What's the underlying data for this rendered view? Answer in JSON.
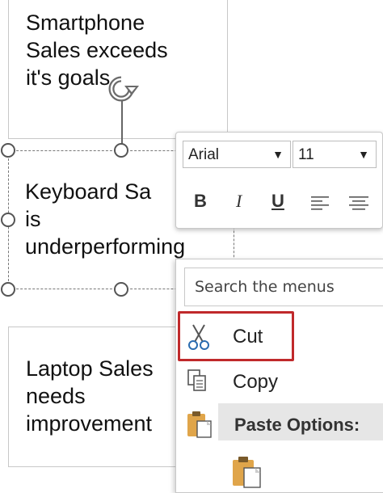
{
  "textboxes": {
    "smartphone": "Smartphone\nSales exceeds\nit's goals",
    "keyboard": "Keyboard Sa\nis\nunderperforming",
    "laptop": "Laptop Sales\nneeds\nimprovement"
  },
  "mini_toolbar": {
    "font_name": "Arial",
    "font_size": "11",
    "bold_label": "B",
    "italic_label": "I",
    "underline_label": "U"
  },
  "context_menu": {
    "search_placeholder": "Search the menus",
    "items": [
      {
        "label": "Cut",
        "icon": "scissors-icon"
      },
      {
        "label": "Copy",
        "icon": "copy-icon"
      },
      {
        "label": "Paste Options:",
        "icon": "paste-icon"
      }
    ]
  },
  "colors": {
    "highlight": "#c0292b",
    "paste_header_bg": "#e6e6e6"
  }
}
